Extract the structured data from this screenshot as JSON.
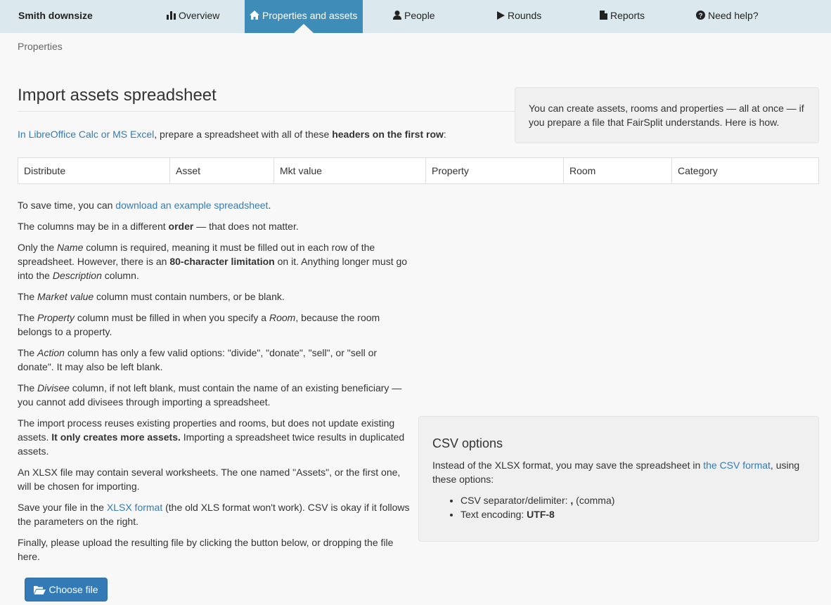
{
  "nav": {
    "brand": "Smith downsize",
    "items": [
      {
        "label": "Overview",
        "icon": "bar-chart-icon"
      },
      {
        "label": "Properties and assets",
        "icon": "home-icon"
      },
      {
        "label": "People",
        "icon": "user-icon"
      },
      {
        "label": "Rounds",
        "icon": "play-icon"
      },
      {
        "label": "Reports",
        "icon": "file-icon"
      },
      {
        "label": "Need help?",
        "icon": "question-circle-icon"
      }
    ]
  },
  "breadcrumb": "Properties",
  "title": "Import assets spreadsheet",
  "intro": {
    "link": "In LibreOffice Calc or MS Excel",
    "text1": ", prepare a spreadsheet with all of these ",
    "bold": "headers on the first row",
    "text2": ":"
  },
  "tip": "You can create assets, rooms and properties — all at once — if you prepare a file that FairSplit understands. Here is how.",
  "headers": [
    "Distribute",
    "Asset",
    "Mkt value",
    "Property",
    "Room",
    "Category"
  ],
  "paragraphs": {
    "p1a": "To save time, you can ",
    "p1link": "download an example spreadsheet",
    "p1b": ".",
    "p2a": "The columns may be in a different ",
    "p2bold": "order",
    "p2b": " — that does not matter.",
    "p3a": "Only the ",
    "p3em1": "Name",
    "p3b": " column is required, meaning it must be filled out in each row of the spreadsheet. However, there is an ",
    "p3bold": "80-character limitation",
    "p3c": " on it. Anything longer must go into the ",
    "p3em2": "Description",
    "p3d": " column.",
    "p4a": "The ",
    "p4em": "Market value",
    "p4b": " column must contain numbers, or be blank.",
    "p5a": "The ",
    "p5em1": "Property",
    "p5b": " column must be filled in when you specify a ",
    "p5em2": "Room",
    "p5c": ", because the room belongs to a property.",
    "p6a": "The ",
    "p6em": "Action",
    "p6b": " column has only a few valid options: \"divide\", \"donate\", \"sell\", or \"sell or donate\". It may also be left blank.",
    "p7a": "The ",
    "p7em": "Divisee",
    "p7b": " column, if not left blank, must contain the name of an existing beneficiary — you cannot add divisees through importing a spreadsheet.",
    "p8a": "The import process reuses existing properties and rooms, but does not update existing assets. ",
    "p8bold": "It only creates more assets.",
    "p8b": " Importing a spreadsheet twice results in duplicated assets.",
    "p9": "An XLSX file may contain several worksheets. The one named \"Assets\", or the first one, will be chosen for importing.",
    "p10a": "Save your file in the ",
    "p10link": "XLSX format",
    "p10b": " (the old XLS format won't work). CSV is okay if it follows the parameters on the right.",
    "p11": "Finally, please upload the resulting file by clicking the button below, or dropping the file here."
  },
  "csv": {
    "title": "CSV options",
    "texta": "Instead of the XLSX format, you may save the spreadsheet in ",
    "link": "the CSV format",
    "textb": ", using these options:",
    "opt1label": "CSV separator/delimiter: ",
    "opt1bold": ",",
    "opt1rest": " (comma)",
    "opt2label": "Text encoding: ",
    "opt2bold": "UTF-8"
  },
  "button": {
    "label": "Choose file",
    "icon": "folder-open-icon"
  }
}
